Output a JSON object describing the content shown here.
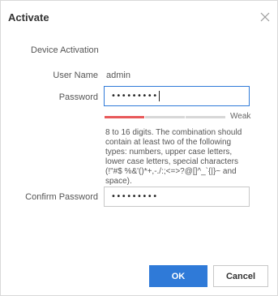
{
  "dialog": {
    "title": "Activate",
    "section_title": "Device Activation",
    "user_name": {
      "label": "User Name",
      "value": "admin"
    },
    "password": {
      "label": "Password",
      "value": "•••••••••"
    },
    "strength": {
      "label": "Weak",
      "level": 0.33,
      "color": "#e8595a"
    },
    "hint": "8 to 16 digits. The combination should contain at least two of the following types: numbers, upper case letters, lower case letters, special characters (!\"#$ %&'()*+,-./:;<=>?@[]^_`{|}~ and space).",
    "confirm_password": {
      "label": "Confirm Password",
      "value": "•••••••••"
    },
    "buttons": {
      "ok": "OK",
      "cancel": "Cancel"
    },
    "icons": {
      "close": "close-icon"
    },
    "colors": {
      "accent": "#2f7ad8",
      "weak": "#e8595a"
    }
  }
}
